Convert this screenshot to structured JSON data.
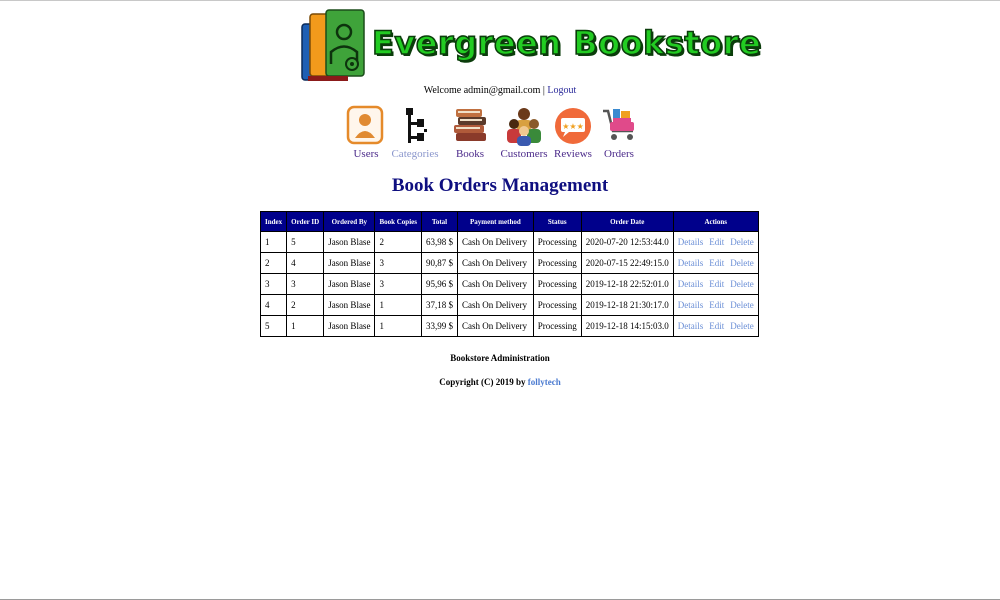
{
  "brand": {
    "title": "Evergreen Bookstore",
    "logo_icon": "books-admin-logo-icon"
  },
  "header": {
    "welcome_prefix": "Welcome",
    "user_email": "admin@gmail.com",
    "separator": "|",
    "logout_label": "Logout"
  },
  "nav": {
    "items": [
      {
        "label": "Users",
        "icon": "user-icon"
      },
      {
        "label": "Categories",
        "icon": "category-tree-icon",
        "active": true
      },
      {
        "label": "Books",
        "icon": "book-stack-icon"
      },
      {
        "label": "Customers",
        "icon": "customers-group-icon"
      },
      {
        "label": "Reviews",
        "icon": "reviews-stars-icon"
      },
      {
        "label": "Orders",
        "icon": "shopping-cart-icon"
      }
    ]
  },
  "page": {
    "title": "Book Orders Management"
  },
  "table": {
    "columns": [
      "Index",
      "Order ID",
      "Ordered By",
      "Book Copies",
      "Total",
      "Payment method",
      "Status",
      "Order Date",
      "Actions"
    ],
    "rows": [
      {
        "index": "1",
        "order_id": "5",
        "ordered_by": "Jason Blase",
        "copies": "2",
        "total": "63,98 $",
        "payment": "Cash On Delivery",
        "status": "Processing",
        "date": "2020-07-20 12:53:44.0"
      },
      {
        "index": "2",
        "order_id": "4",
        "ordered_by": "Jason Blase",
        "copies": "3",
        "total": "90,87 $",
        "payment": "Cash On Delivery",
        "status": "Processing",
        "date": "2020-07-15 22:49:15.0"
      },
      {
        "index": "3",
        "order_id": "3",
        "ordered_by": "Jason Blase",
        "copies": "3",
        "total": "95,96 $",
        "payment": "Cash On Delivery",
        "status": "Processing",
        "date": "2019-12-18 22:52:01.0"
      },
      {
        "index": "4",
        "order_id": "2",
        "ordered_by": "Jason Blase",
        "copies": "1",
        "total": "37,18 $",
        "payment": "Cash On Delivery",
        "status": "Processing",
        "date": "2019-12-18 21:30:17.0"
      },
      {
        "index": "5",
        "order_id": "1",
        "ordered_by": "Jason Blase",
        "copies": "1",
        "total": "33,99 $",
        "payment": "Cash On Delivery",
        "status": "Processing",
        "date": "2019-12-18 14:15:03.0"
      }
    ],
    "actions": {
      "details": "Details",
      "edit": "Edit",
      "delete": "Delete"
    }
  },
  "footer": {
    "title": "Bookstore Administration",
    "copyright_prefix": "Copyright (C) 2019 by",
    "author": "follytech"
  },
  "colors": {
    "title_blue": "#0f0f80",
    "table_header_bg": "#00008b",
    "link_action": "#6b8fd6",
    "brand_green": "#22cc22",
    "nav_label": "#4b2a8a",
    "nav_label_active": "#8a96cc"
  }
}
